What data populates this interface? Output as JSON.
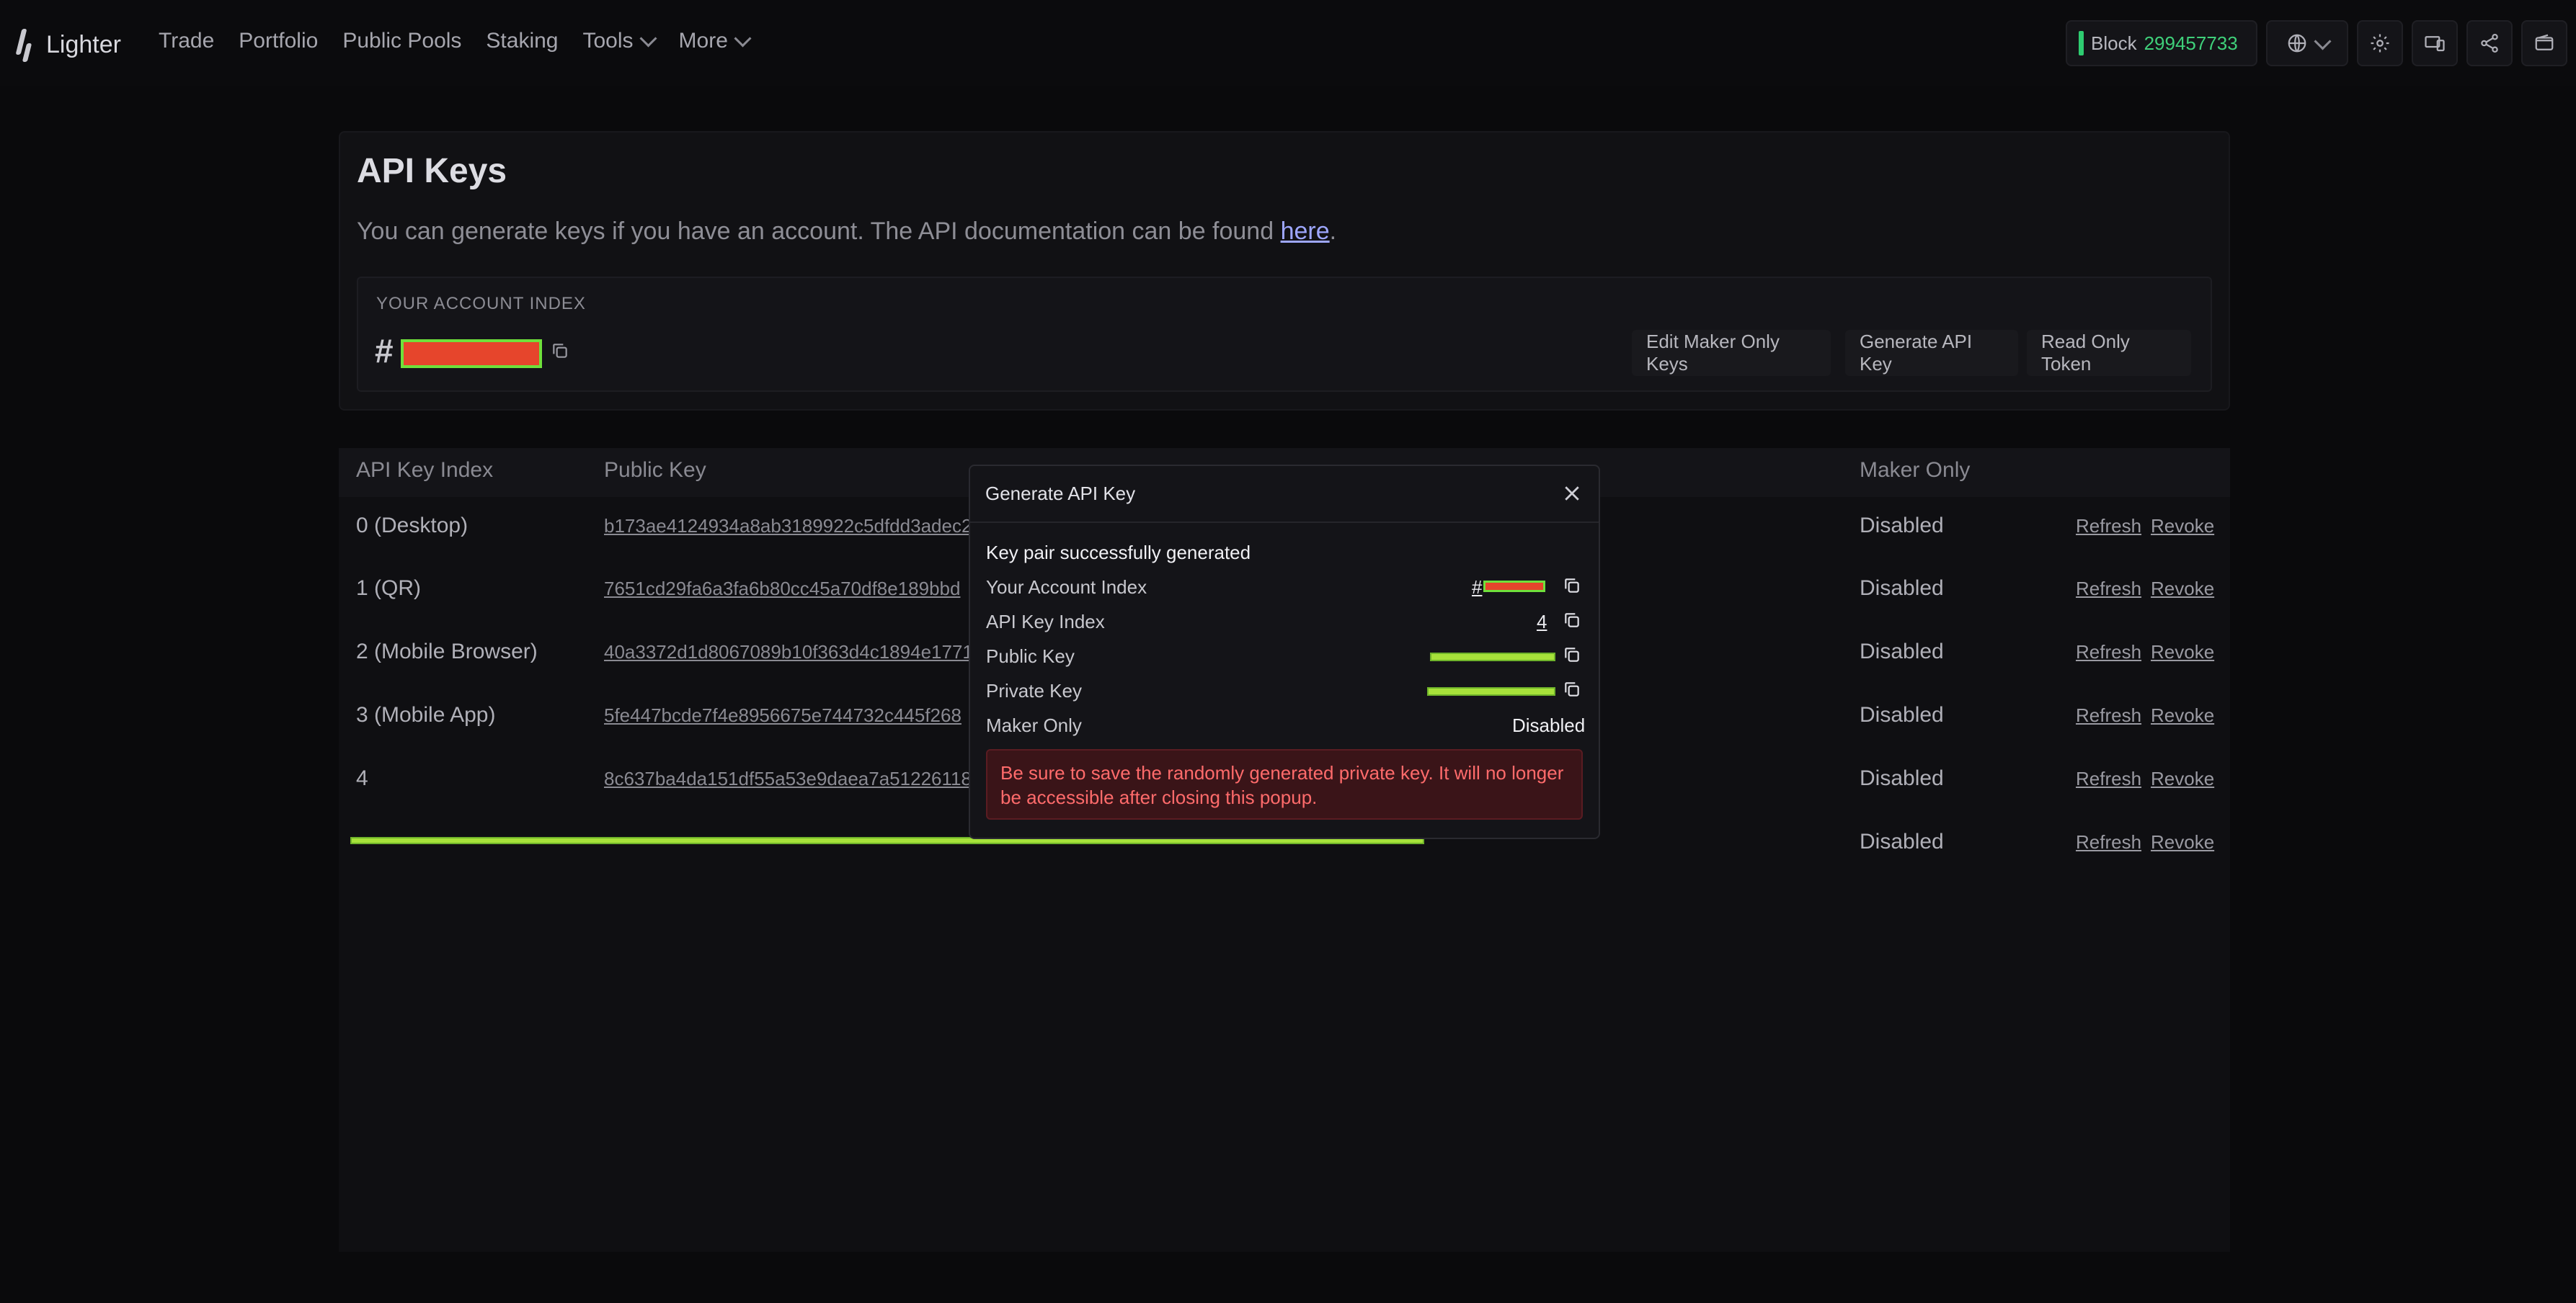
{
  "app": {
    "name": "Lighter"
  },
  "nav": {
    "trade": "Trade",
    "portfolio": "Portfolio",
    "public_pools": "Public Pools",
    "staking": "Staking",
    "tools": "Tools",
    "more": "More"
  },
  "status": {
    "block_label": "Block",
    "block_number": "299457733"
  },
  "page": {
    "title": "API Keys",
    "description_pre": "You can generate keys if you have an account. The API documentation can be found ",
    "description_link": "here",
    "description_post": ".",
    "account_index_label": "YOUR ACCOUNT INDEX",
    "account_index_prefix": "#",
    "buttons": {
      "edit_maker": "Edit Maker Only Keys",
      "generate": "Generate API Key",
      "read_only": "Read Only Token"
    }
  },
  "table": {
    "headers": {
      "index": "API Key Index",
      "public_key": "Public Key",
      "maker_only": "Maker Only"
    },
    "rows": [
      {
        "index": "0 (Desktop)",
        "public_key": "b173ae4124934a8ab3189922c5dfdd3adec2",
        "maker_only": "Disabled",
        "refresh": "Refresh",
        "revoke": "Revoke"
      },
      {
        "index": "1 (QR)",
        "public_key": "7651cd29fa6a3fa6b80cc45a70df8e189bbd",
        "maker_only": "Disabled",
        "refresh": "Refresh",
        "revoke": "Revoke"
      },
      {
        "index": "2 (Mobile Browser)",
        "public_key": "40a3372d1d8067089b10f363d4c1894e1771",
        "maker_only": "Disabled",
        "refresh": "Refresh",
        "revoke": "Revoke"
      },
      {
        "index": "3 (Mobile App)",
        "public_key": "5fe447bcde7f4e8956675e744732c445f268",
        "maker_only": "Disabled",
        "refresh": "Refresh",
        "revoke": "Revoke"
      },
      {
        "index": "4",
        "public_key": "8c637ba4da151df55a53e9daea7a512261182",
        "maker_only": "Disabled",
        "refresh": "Refresh",
        "revoke": "Revoke"
      },
      {
        "index": "",
        "public_key": "",
        "maker_only": "Disabled",
        "refresh": "Refresh",
        "revoke": "Revoke"
      }
    ]
  },
  "modal": {
    "title": "Generate API Key",
    "success": "Key pair successfully generated",
    "account_index_label": "Your Account Index",
    "account_index_prefix": "#",
    "api_key_index_label": "API Key Index",
    "api_key_index_value": "4",
    "public_key_label": "Public Key",
    "private_key_label": "Private Key",
    "maker_only_label": "Maker Only",
    "maker_only_value": "Disabled",
    "warning": "Be sure to save the randomly generated private key. It will no longer be accessible after closing this popup."
  },
  "colors": {
    "accent_green": "#3fd07a",
    "warning_red": "#ff6b6b",
    "link_purple": "#9ea7ff"
  }
}
